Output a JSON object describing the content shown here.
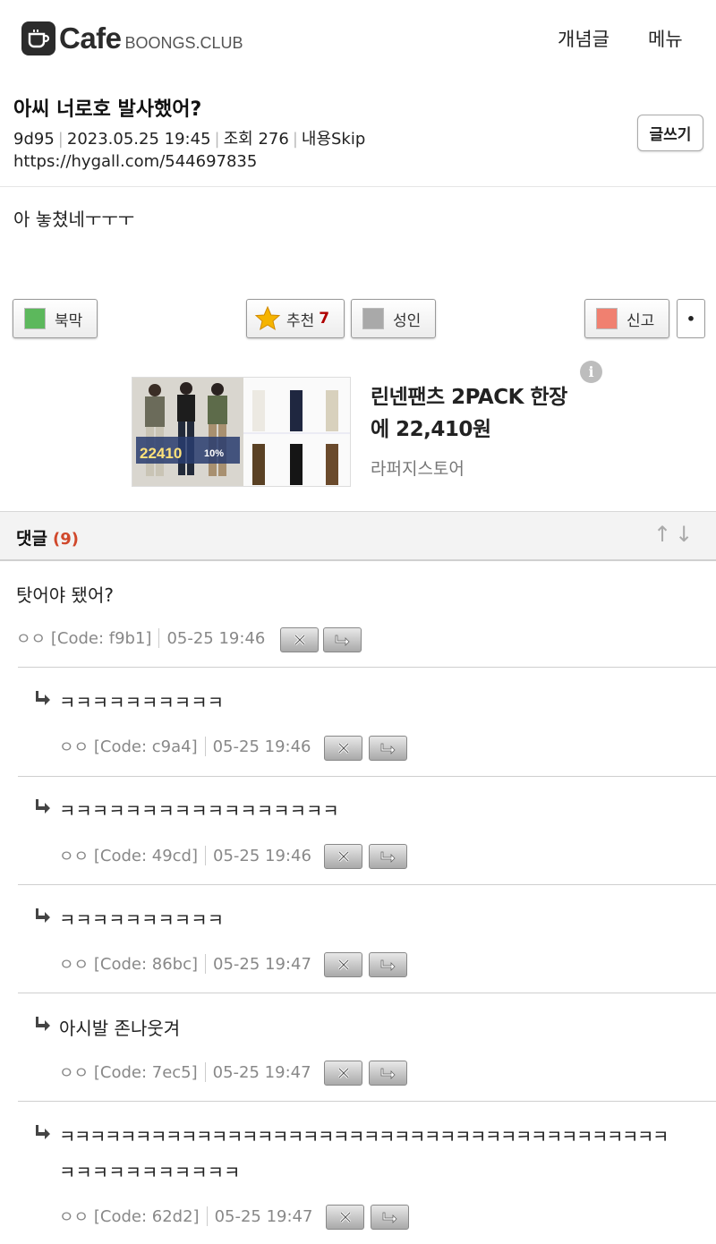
{
  "header": {
    "logo_word": "Cafe",
    "logo_domain": "BOONGS.CLUB",
    "nav_concept": "개념글",
    "nav_menu": "메뉴"
  },
  "article": {
    "title": "아씨 너로호 발사했어?",
    "author_code": "9d95",
    "datetime": "2023.05.25 19:45",
    "views": "조회 276",
    "skip": "내용Skip",
    "url": "https://hygall.com/544697835",
    "write_label": "글쓰기",
    "body": "아 놓쳤네ㅜㅜㅜ"
  },
  "actions": {
    "bukmak": "북막",
    "recommend": "추천",
    "recommend_count": "7",
    "adult": "성인",
    "report": "신고",
    "more": "•",
    "colors": {
      "bukmak": "#5cb85c",
      "recommend": "#f0b400",
      "adult": "#a9a9a9",
      "report": "#f08070"
    }
  },
  "ad": {
    "title": "린넨팬츠 2PACK 한장에 22,410원",
    "store": "라퍼지스토어",
    "info": "i",
    "image_price": "22410",
    "image_discount": "10%"
  },
  "comments_header": {
    "label": "댓글",
    "count": "(9)",
    "sort": "↑↓"
  },
  "comments": [
    {
      "text": "탓어야 됐어?",
      "nick": "ㅇㅇ",
      "code": "[Code: f9b1]",
      "time": "05-25 19:46"
    },
    {
      "text": "ㅋㅋㅋㅋㅋㅋㅋㅋㅋㅋ",
      "nick": "ㅇㅇ",
      "code": "[Code: c9a4]",
      "time": "05-25 19:46"
    },
    {
      "text": "ㅋㅋㅋㅋㅋㅋㅋㅋㅋㅋㅋㅋㅋㅋㅋㅋㅋ",
      "nick": "ㅇㅇ",
      "code": "[Code: 49cd]",
      "time": "05-25 19:46"
    },
    {
      "text": "ㅋㅋㅋㅋㅋㅋㅋㅋㅋㅋ",
      "nick": "ㅇㅇ",
      "code": "[Code: 86bc]",
      "time": "05-25 19:47"
    },
    {
      "text": "아시발 존나웃겨",
      "nick": "ㅇㅇ",
      "code": "[Code: 7ec5]",
      "time": "05-25 19:47"
    },
    {
      "text": "ㅋㅋㅋㅋㅋㅋㅋㅋㅋㅋㅋㅋㅋㅋㅋㅋㅋㅋㅋㅋㅋㅋㅋㅋㅋㅋㅋㅋㅋㅋㅋㅋㅋㅋㅋㅋㅋㅋㅋㅋ",
      "text2": "ㅋㅋㅋㅋㅋㅋㅋㅋㅋㅋㅋ",
      "nick": "ㅇㅇ",
      "code": "[Code: 62d2]",
      "time": "05-25 19:47"
    }
  ]
}
